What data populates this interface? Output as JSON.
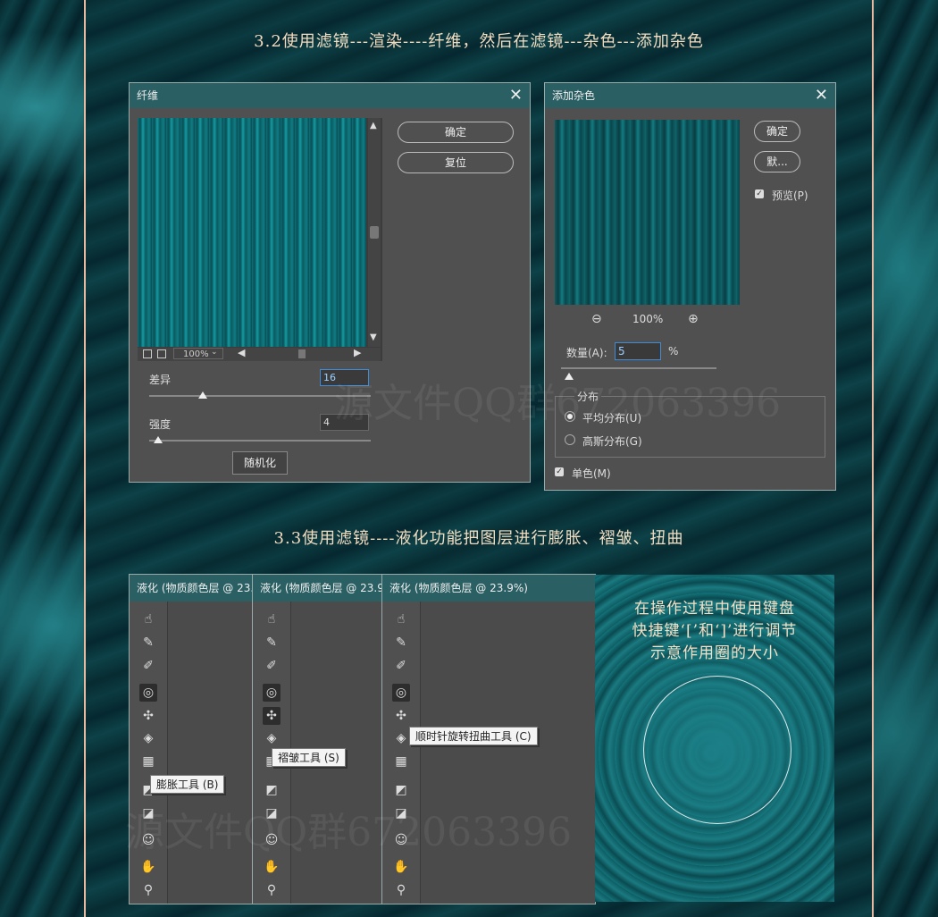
{
  "headings": {
    "h1": "3.2使用滤镜---渲染----纤维，然后在滤镜---杂色---添加杂色",
    "h2": "3.3使用滤镜----液化功能把图层进行膨胀、褶皱、扭曲"
  },
  "fiber": {
    "title": "纤维",
    "ok": "确定",
    "reset": "复位",
    "zoom": "100%",
    "variance_label": "差异",
    "variance_value": "16",
    "variance_level": 0.3,
    "strength_label": "强度",
    "strength_value": "4",
    "strength_level": 0.05,
    "randomize": "随机化"
  },
  "noise": {
    "title": "添加杂色",
    "ok": "确定",
    "default": "默...",
    "preview_label": "预览(P)",
    "zoom": "100%",
    "amount_label": "数量(A):",
    "amount_value": "5",
    "percent": "%",
    "amount_level": 0.05,
    "dist_label": "分布",
    "uniform": "平均分布(U)",
    "gaussian": "高斯分布(G)",
    "mono": "单色(M)"
  },
  "liquify": {
    "titles": [
      "液化 (物质颜色层 @ 23.",
      "液化 (物质颜色层 @ 23.9",
      "液化 (物质颜色层 @ 23.9%)"
    ],
    "tooltips": [
      "膨胀工具 (B)",
      "褶皱工具 (S)",
      "顺时针旋转扭曲工具 (C)"
    ]
  },
  "note": {
    "line1": "在操作过程中使用键盘",
    "line2": "快捷键‘[’和‘]’进行调节",
    "line3": "示意作用圈的大小"
  },
  "watermark": "源文件QQ群672063396"
}
